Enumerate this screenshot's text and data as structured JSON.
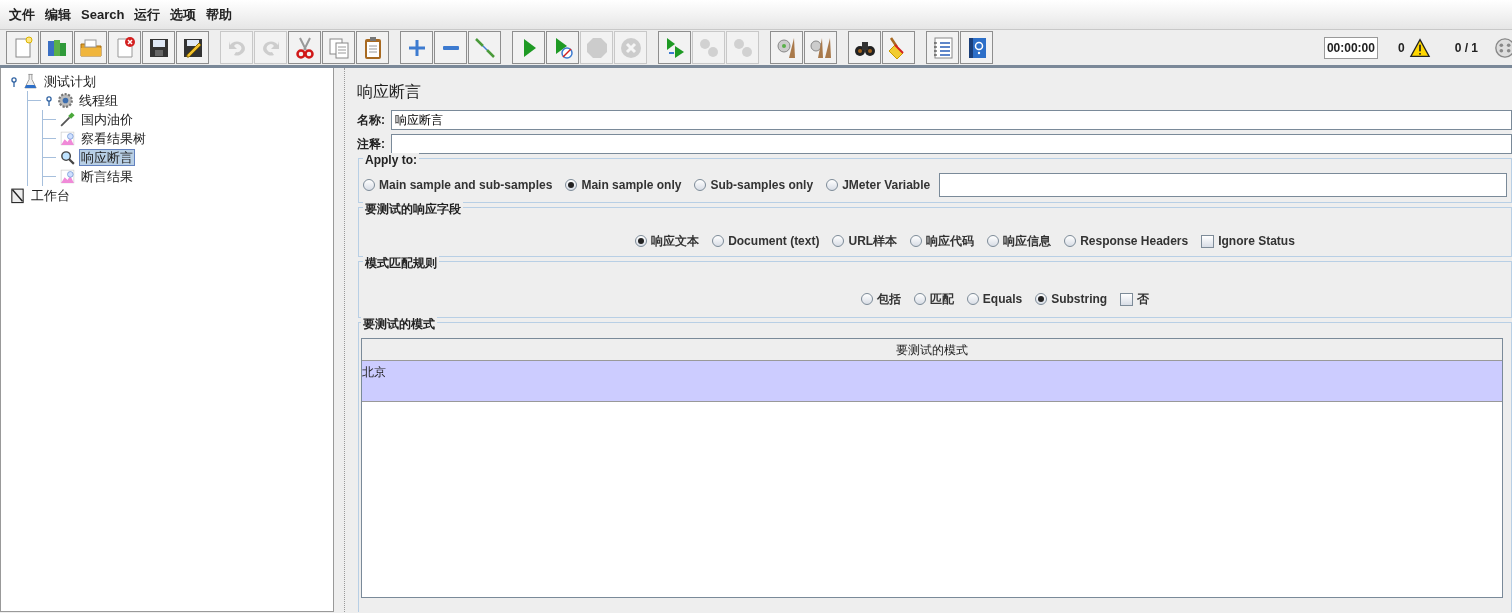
{
  "menu": [
    "文件",
    "编辑",
    "Search",
    "运行",
    "选项",
    "帮助"
  ],
  "toolbar": {
    "groups": [
      [
        {
          "disabled": false
        },
        {
          "disabled": false
        },
        {
          "disabled": false
        },
        {
          "disabled": false
        },
        {
          "disabled": false
        },
        {
          "disabled": false
        }
      ],
      [
        {
          "disabled": true
        },
        {
          "disabled": true
        },
        {
          "disabled": false
        },
        {
          "disabled": false
        },
        {
          "disabled": false
        }
      ],
      [
        {
          "disabled": false
        },
        {
          "disabled": false
        },
        {
          "disabled": false
        }
      ],
      [
        {
          "disabled": false
        },
        {
          "disabled": false
        },
        {
          "disabled": true
        },
        {
          "disabled": true
        }
      ],
      [
        {
          "disabled": false
        },
        {
          "disabled": true
        },
        {
          "disabled": true
        }
      ],
      [
        {
          "disabled": false
        },
        {
          "disabled": false
        }
      ],
      [
        {
          "disabled": false
        },
        {
          "disabled": false
        }
      ],
      [
        {
          "disabled": false
        },
        {
          "disabled": false
        }
      ]
    ]
  },
  "status": {
    "timer": "00:00:00",
    "errors": "0",
    "threads": "0 / 1"
  },
  "tree": [
    {
      "label": "测试计划",
      "kind": "plan",
      "selected": false,
      "expanded": true,
      "children": [
        {
          "label": "线程组",
          "kind": "thread_group",
          "selected": false,
          "expanded": true,
          "children": [
            {
              "label": "国内油价",
              "kind": "sampler",
              "selected": false
            },
            {
              "label": "察看结果树",
              "kind": "listener",
              "selected": false
            },
            {
              "label": "响应断言",
              "kind": "assertion",
              "selected": true
            },
            {
              "label": "断言结果",
              "kind": "listener",
              "selected": false
            }
          ]
        }
      ]
    },
    {
      "label": "工作台",
      "kind": "workbench",
      "selected": false
    }
  ],
  "editor": {
    "title": "响应断言",
    "name": {
      "label": "名称:",
      "value": "响应断言"
    },
    "comment": {
      "label": "注释:"
    },
    "apply_to": {
      "legend": "Apply to:",
      "options": [
        {
          "label": "Main sample and sub-samples",
          "selected": false
        },
        {
          "label": "Main sample only",
          "selected": true
        },
        {
          "label": "Sub-samples only",
          "selected": false
        },
        {
          "label": "JMeter Variable",
          "selected": false
        }
      ]
    },
    "response_field": {
      "legend": "要测试的响应字段",
      "options": [
        {
          "label": "响应文本",
          "selected": true
        },
        {
          "label": "Document (text)",
          "selected": false
        },
        {
          "label": "URL样本",
          "selected": false
        },
        {
          "label": "响应代码",
          "selected": false
        },
        {
          "label": "响应信息",
          "selected": false
        },
        {
          "label": "Response Headers",
          "selected": false
        }
      ],
      "ignore_status": {
        "label": "Ignore Status",
        "checked": false
      }
    },
    "matching_rules": {
      "legend": "模式匹配规则",
      "options": [
        {
          "label": "包括",
          "selected": false
        },
        {
          "label": "匹配",
          "selected": false
        },
        {
          "label": "Equals",
          "selected": false
        },
        {
          "label": "Substring",
          "selected": true
        }
      ],
      "negate": {
        "label": "否",
        "checked": false
      }
    },
    "patterns": {
      "legend": "要测试的模式",
      "column": "要测试的模式",
      "rows": [
        {
          "value": "北京",
          "selected": true
        }
      ]
    }
  }
}
